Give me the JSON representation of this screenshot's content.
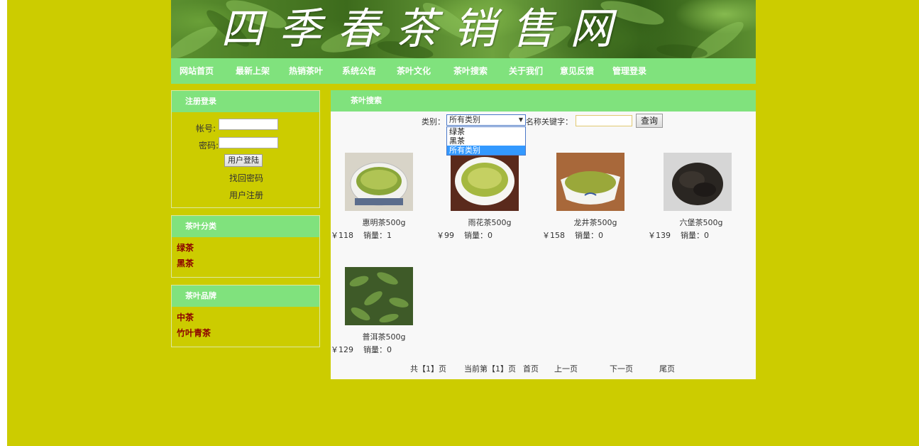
{
  "banner": {
    "title": "四季春茶销售网"
  },
  "nav": [
    "网站首页",
    "最新上架",
    "热销茶叶",
    "系统公告",
    "茶叶文化",
    "茶叶搜索",
    "关于我们",
    "意见反馈",
    "管理登录"
  ],
  "login": {
    "title": "注册登录",
    "account_label": "帐号:",
    "password_label": "密码:",
    "login_button": "用户登陆",
    "recover_link": "找回密码",
    "register_link": "用户注册"
  },
  "categories": {
    "title": "茶叶分类",
    "items": [
      "绿茶",
      "黑茶"
    ]
  },
  "brands": {
    "title": "茶叶品牌",
    "items": [
      "中茶",
      "竹叶青茶"
    ]
  },
  "search": {
    "title": "茶叶搜索",
    "category_label": "类别：",
    "selected_category": "所有类别",
    "options": [
      "绿茶",
      "黑茶",
      "所有类别"
    ],
    "keyword_label": "名称关键字：",
    "keyword_value": "",
    "query_button": "查询"
  },
  "products": [
    {
      "name": "惠明茶500g",
      "price": "￥118",
      "sales": "销量：1",
      "icon": "green-tea-cup"
    },
    {
      "name": "雨花茶500g",
      "price": "￥99",
      "sales": "销量：0",
      "icon": "green-tea-bowl"
    },
    {
      "name": "龙井茶500g",
      "price": "￥158",
      "sales": "销量：0",
      "icon": "longjing-tea"
    },
    {
      "name": "六堡茶500g",
      "price": "￥139",
      "sales": "销量：0",
      "icon": "dark-tea-leaves"
    },
    {
      "name": "普洱茶500g",
      "price": "￥129",
      "sales": "销量：0",
      "icon": "tea-plant"
    }
  ],
  "pager": {
    "total": "共【1】页",
    "current": "当前第【1】页",
    "first": "首页",
    "prev": "上一页",
    "next": "下一页",
    "last": "尾页"
  },
  "colors": {
    "background": "#cccc00",
    "nav_green": "#80e27d",
    "link_red": "#8b0000",
    "content_bg": "#f8f8f8"
  }
}
